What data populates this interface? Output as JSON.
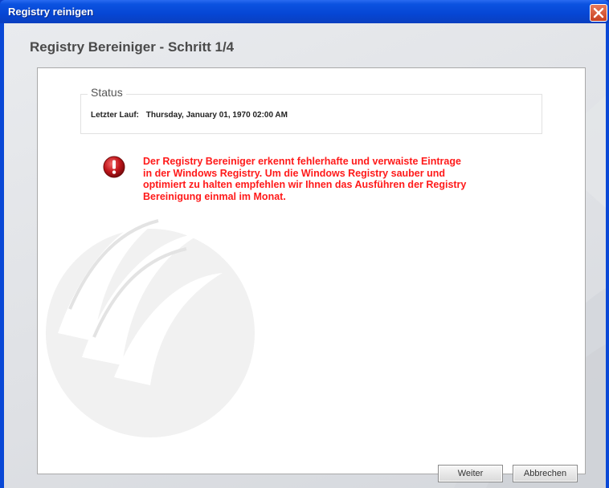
{
  "window": {
    "title": "Registry reinigen"
  },
  "page": {
    "heading": "Registry Bereiniger - Schritt 1/4"
  },
  "status": {
    "legend": "Status",
    "last_run_label": "Letzter Lauf:",
    "last_run_value": "Thursday, January 01, 1970  02:00 AM"
  },
  "message": {
    "icon": "exclamation-icon",
    "lines": [
      "Der Registry Bereiniger erkennt fehlerhafte und verwaiste Eintrage",
      "in der Windows Registry. Um die Windows Registry sauber und",
      "optimiert zu halten empfehlen wir Ihnen das Ausführen der Registry",
      "Bereinigung einmal im Monat."
    ],
    "color": "#ff1a1a"
  },
  "buttons": {
    "next": "Weiter",
    "cancel": "Abbrechen"
  },
  "colors": {
    "titlebar": "#0646d4",
    "close": "#c8401f",
    "alert": "#c0151a"
  }
}
